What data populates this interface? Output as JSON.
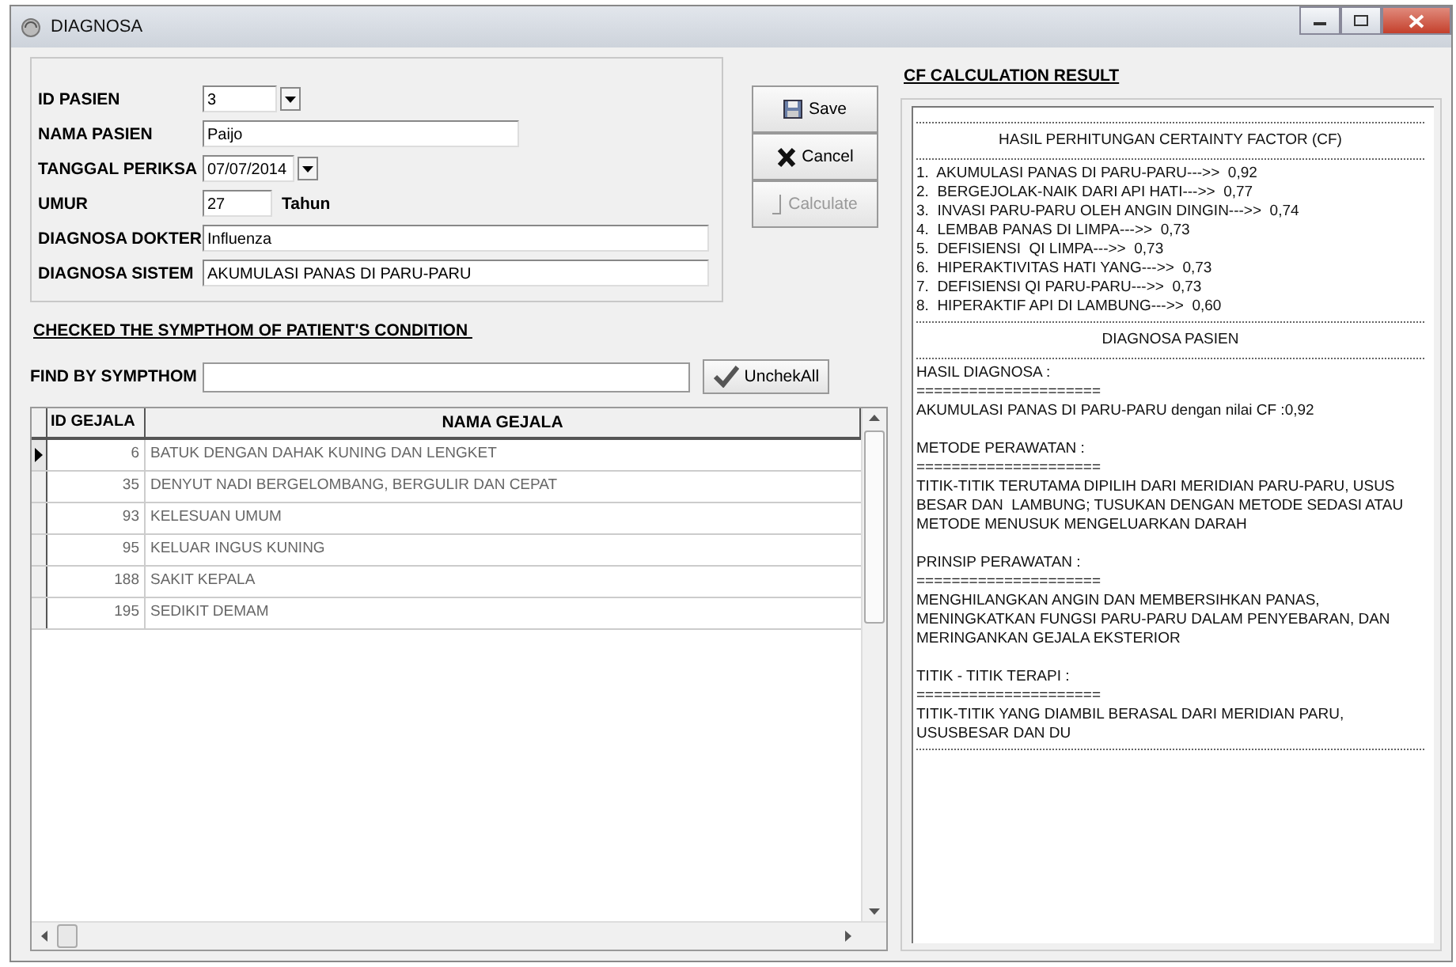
{
  "window": {
    "title": "DIAGNOSA"
  },
  "form": {
    "fields": [
      {
        "label": "ID PASIEN",
        "value": "3",
        "kind": "combo"
      },
      {
        "label": "NAMA PASIEN",
        "value": "Paijo",
        "kind": "text"
      },
      {
        "label": "TANGGAL PERIKSA",
        "value": "07/07/2014",
        "kind": "date"
      },
      {
        "label": "UMUR",
        "value": "27",
        "kind": "age",
        "suffix": "Tahun"
      },
      {
        "label": "DIAGNOSA DOKTER",
        "value": "Influenza",
        "kind": "wide"
      },
      {
        "label": "DIAGNOSA SISTEM",
        "value": "AKUMULASI PANAS DI PARU-PARU",
        "kind": "wide"
      }
    ]
  },
  "buttons": [
    {
      "label": "Save",
      "kind": "save",
      "disabled": false
    },
    {
      "label": "Cancel",
      "kind": "cancel",
      "disabled": false
    },
    {
      "label": "Calculate",
      "kind": "calculate",
      "disabled": true
    }
  ],
  "symptom_heading": "CHECKED THE SYMPTHOM OF PATIENT'S CONDITION ",
  "find": {
    "label": "FIND BY SYMPTHOM",
    "button": "UnchekAll"
  },
  "table": {
    "columns": [
      "ID GEJALA",
      "NAMA GEJALA"
    ],
    "rows": [
      {
        "id": "6",
        "name": "BATUK DENGAN DAHAK KUNING DAN LENGKET",
        "selected": true
      },
      {
        "id": "35",
        "name": "DENYUT NADI BERGELOMBANG, BERGULIR DAN CEPAT",
        "selected": false
      },
      {
        "id": "93",
        "name": "KELESUAN UMUM",
        "selected": false
      },
      {
        "id": "95",
        "name": "KELUAR INGUS KUNING",
        "selected": false
      },
      {
        "id": "188",
        "name": "SAKIT KEPALA",
        "selected": false
      },
      {
        "id": "195",
        "name": "SEDIKIT DEMAM",
        "selected": false
      }
    ]
  },
  "result": {
    "title": "CF CALCULATION RESULT",
    "lines": [
      {
        "kind": "rule"
      },
      {
        "kind": "heading",
        "text": "HASIL PERHITUNGAN CERTAINTY FACTOR (CF)"
      },
      {
        "kind": "rule"
      },
      {
        "kind": "line",
        "text": "1.  AKUMULASI PANAS DI PARU-PARU--->>  0,92"
      },
      {
        "kind": "line",
        "text": "2.  BERGEJOLAK-NAIK DARI API HATI--->>  0,77"
      },
      {
        "kind": "line",
        "text": "3.  INVASI PARU-PARU OLEH ANGIN DINGIN--->>  0,74"
      },
      {
        "kind": "line",
        "text": "4.  LEMBAB PANAS DI LIMPA--->>  0,73"
      },
      {
        "kind": "line",
        "text": "5.  DEFISIENSI  QI LIMPA--->>  0,73"
      },
      {
        "kind": "line",
        "text": "6.  HIPERAKTIVITAS HATI YANG--->>  0,73"
      },
      {
        "kind": "line",
        "text": "7.  DEFISIENSI QI PARU-PARU--->>  0,73"
      },
      {
        "kind": "line",
        "text": "8.  HIPERAKTIF API DI LAMBUNG--->>  0,60"
      },
      {
        "kind": "rule"
      },
      {
        "kind": "heading",
        "text": "DIAGNOSA PASIEN"
      },
      {
        "kind": "rule"
      },
      {
        "kind": "line",
        "text": "HASIL DIAGNOSA :"
      },
      {
        "kind": "line",
        "text": "====================="
      },
      {
        "kind": "line",
        "text": "AKUMULASI PANAS DI PARU-PARU dengan nilai CF :0,92"
      },
      {
        "kind": "gap"
      },
      {
        "kind": "line",
        "text": "METODE PERAWATAN :"
      },
      {
        "kind": "line",
        "text": "====================="
      },
      {
        "kind": "line",
        "text": "TITIK-TITIK TERUTAMA DIPILIH DARI MERIDIAN PARU-PARU, USUS BESAR DAN  LAMBUNG; TUSUKAN DENGAN METODE SEDASI ATAU  METODE MENUSUK MENGELUARKAN DARAH"
      },
      {
        "kind": "gap"
      },
      {
        "kind": "line",
        "text": "PRINSIP PERAWATAN :"
      },
      {
        "kind": "line",
        "text": "====================="
      },
      {
        "kind": "line",
        "text": "MENGHILANGKAN ANGIN DAN MEMBERSIHKAN PANAS, MENINGKATKAN FUNGSI PARU-PARU DALAM PENYEBARAN, DAN MERINGANKAN GEJALA EKSTERIOR"
      },
      {
        "kind": "gap"
      },
      {
        "kind": "line",
        "text": "TITIK - TITIK TERAPI :"
      },
      {
        "kind": "line",
        "text": "====================="
      },
      {
        "kind": "line",
        "text": "TITIK-TITIK YANG DIAMBIL BERASAL DARI MERIDIAN PARU, USUSBESAR DAN DU"
      },
      {
        "kind": "rule"
      }
    ]
  }
}
